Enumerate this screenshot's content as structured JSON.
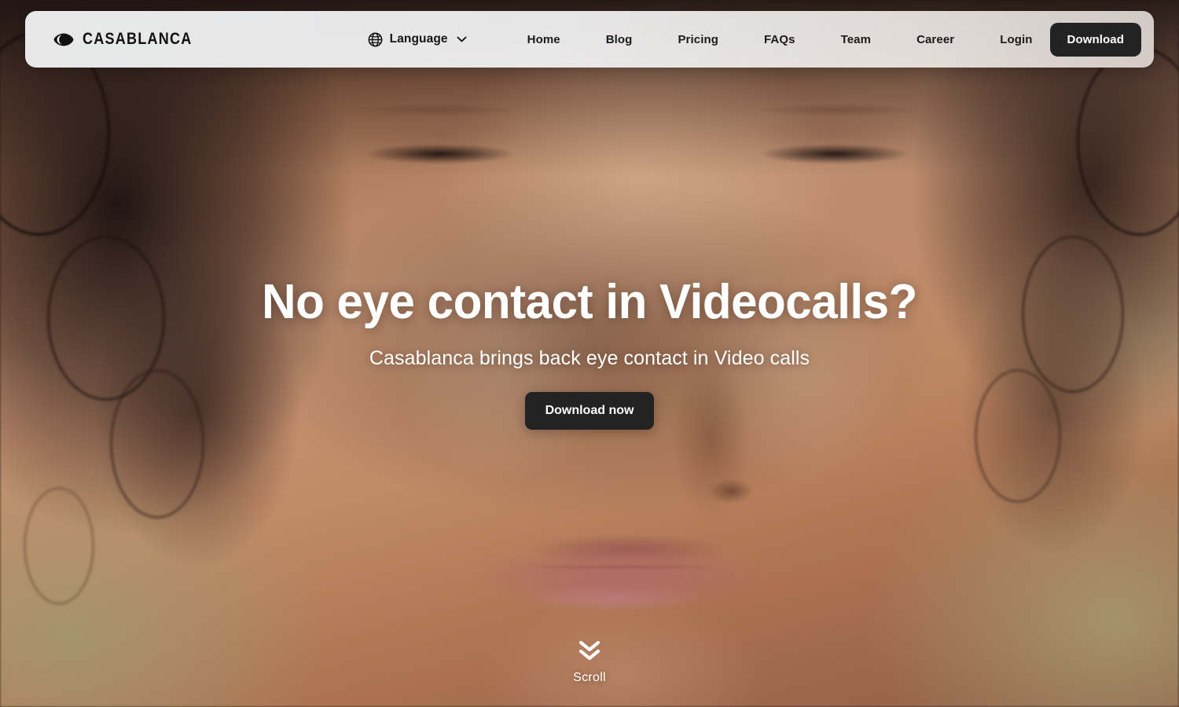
{
  "brand": {
    "name": "CASABLANCA",
    "logo_icon": "eye-icon"
  },
  "navbar": {
    "language": {
      "icon": "globe-icon",
      "label": "Language",
      "chevron_icon": "chevron-down-icon"
    },
    "links": [
      {
        "label": "Home"
      },
      {
        "label": "Blog"
      },
      {
        "label": "Pricing"
      },
      {
        "label": "FAQs"
      },
      {
        "label": "Team"
      },
      {
        "label": "Career"
      },
      {
        "label": "Login"
      }
    ],
    "cta_label": "Download"
  },
  "hero": {
    "title": "No eye contact in Videocalls?",
    "subtitle": "Casablanca brings back eye contact in Video calls",
    "cta_label": "Download now"
  },
  "scroll": {
    "icon": "double-chevron-down-icon",
    "label": "Scroll"
  },
  "colors": {
    "accent_dark": "#232323",
    "navbar_bg": "#eeeff0",
    "text_on_image": "#ffffff",
    "nav_text": "#1b1b1b"
  }
}
